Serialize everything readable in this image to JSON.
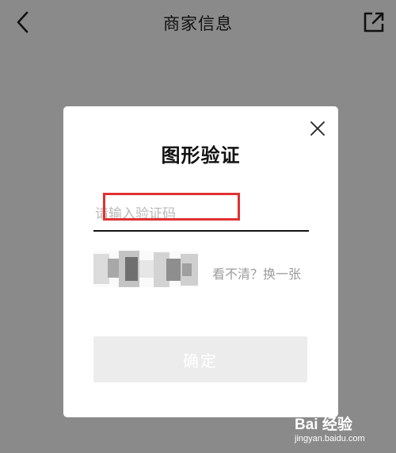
{
  "header": {
    "title": "商家信息",
    "back_icon": "chevron-left-icon",
    "share_icon": "external-link-icon"
  },
  "dialog": {
    "title": "图形验证",
    "input_placeholder": "请输入验证码",
    "captcha_icon": "captcha-image",
    "refresh_label": "看不清？换一张",
    "confirm_label": "确定",
    "close_icon": "close-icon"
  },
  "watermark": {
    "logo_text": "Bai 经验",
    "url": "jingyan.baidu.com"
  },
  "colors": {
    "overlay": "#8a8a8a",
    "dialog_bg": "#ffffff",
    "highlight": "#e13232",
    "button_disabled": "#ececec",
    "muted_text": "#9b9b9b"
  }
}
